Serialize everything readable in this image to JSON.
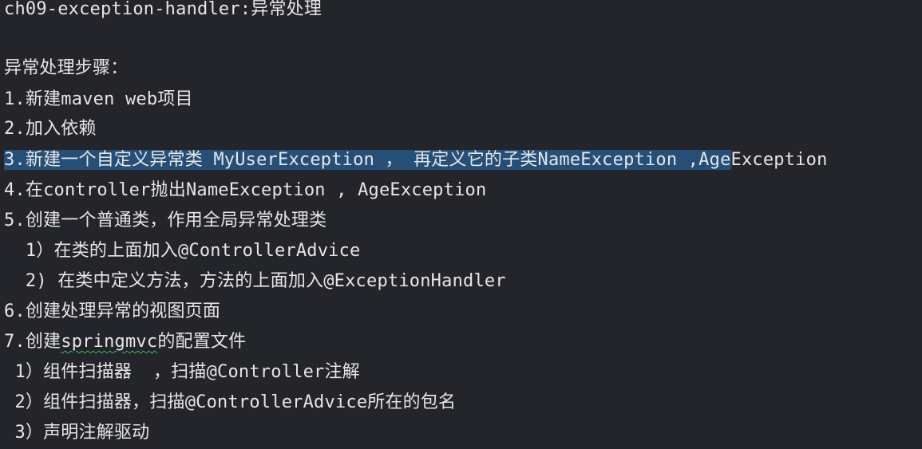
{
  "editor": {
    "lines": {
      "title": "ch09-exception-handler:异常处理",
      "steps_header": "异常处理步骤：",
      "step1": "1.新建maven web项目",
      "step2": "2.加入依赖",
      "step3_selected": "3.新建一个自定义异常类 MyUserException ， 再定义它的子类NameException ,Age",
      "step3_rest": "Exception",
      "step4": "4.在controller抛出NameException , AgeException",
      "step5": "5.创建一个普通类，作用全局异常处理类",
      "step5_1": "  1）在类的上面加入@ControllerAdvice",
      "step5_2": "  2) 在类中定义方法，方法的上面加入@ExceptionHandler",
      "step6": "6.创建处理异常的视图页面",
      "step7_prefix": "7.创建",
      "step7_word": "springmvc",
      "step7_suffix": "的配置文件",
      "step7_1": " 1）组件扫描器  ，扫描@Controller注解",
      "step7_2": " 2）组件扫描器，扫描@ControllerAdvice所在的包名",
      "step7_3": " 3）声明注解驱动"
    },
    "colors": {
      "background": "#23252a",
      "text": "#e6e6e6",
      "selection": "#264f78",
      "spellcheck_underline": "#3fb950"
    }
  }
}
